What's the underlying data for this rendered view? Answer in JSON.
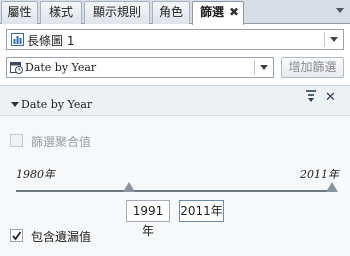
{
  "tabs": [
    {
      "label": "屬性"
    },
    {
      "label": "樣式"
    },
    {
      "label": "顯示規則"
    },
    {
      "label": "角色"
    },
    {
      "label": "篩選"
    }
  ],
  "tab_close": "✖",
  "object_select": {
    "value": "長條圖 1"
  },
  "filter_variable": {
    "value": "Date by Year"
  },
  "add_filter_label": "增加篩選",
  "filter": {
    "title": "Date by Year",
    "close": "✕",
    "filter_aggregate_label": "篩選聚合值",
    "range_min_label": "1980年",
    "range_max_label": "2011年",
    "from_value": "1991年",
    "to_value": "2011年",
    "include_missing_label": "包含遺漏值",
    "include_missing_checked": true
  }
}
